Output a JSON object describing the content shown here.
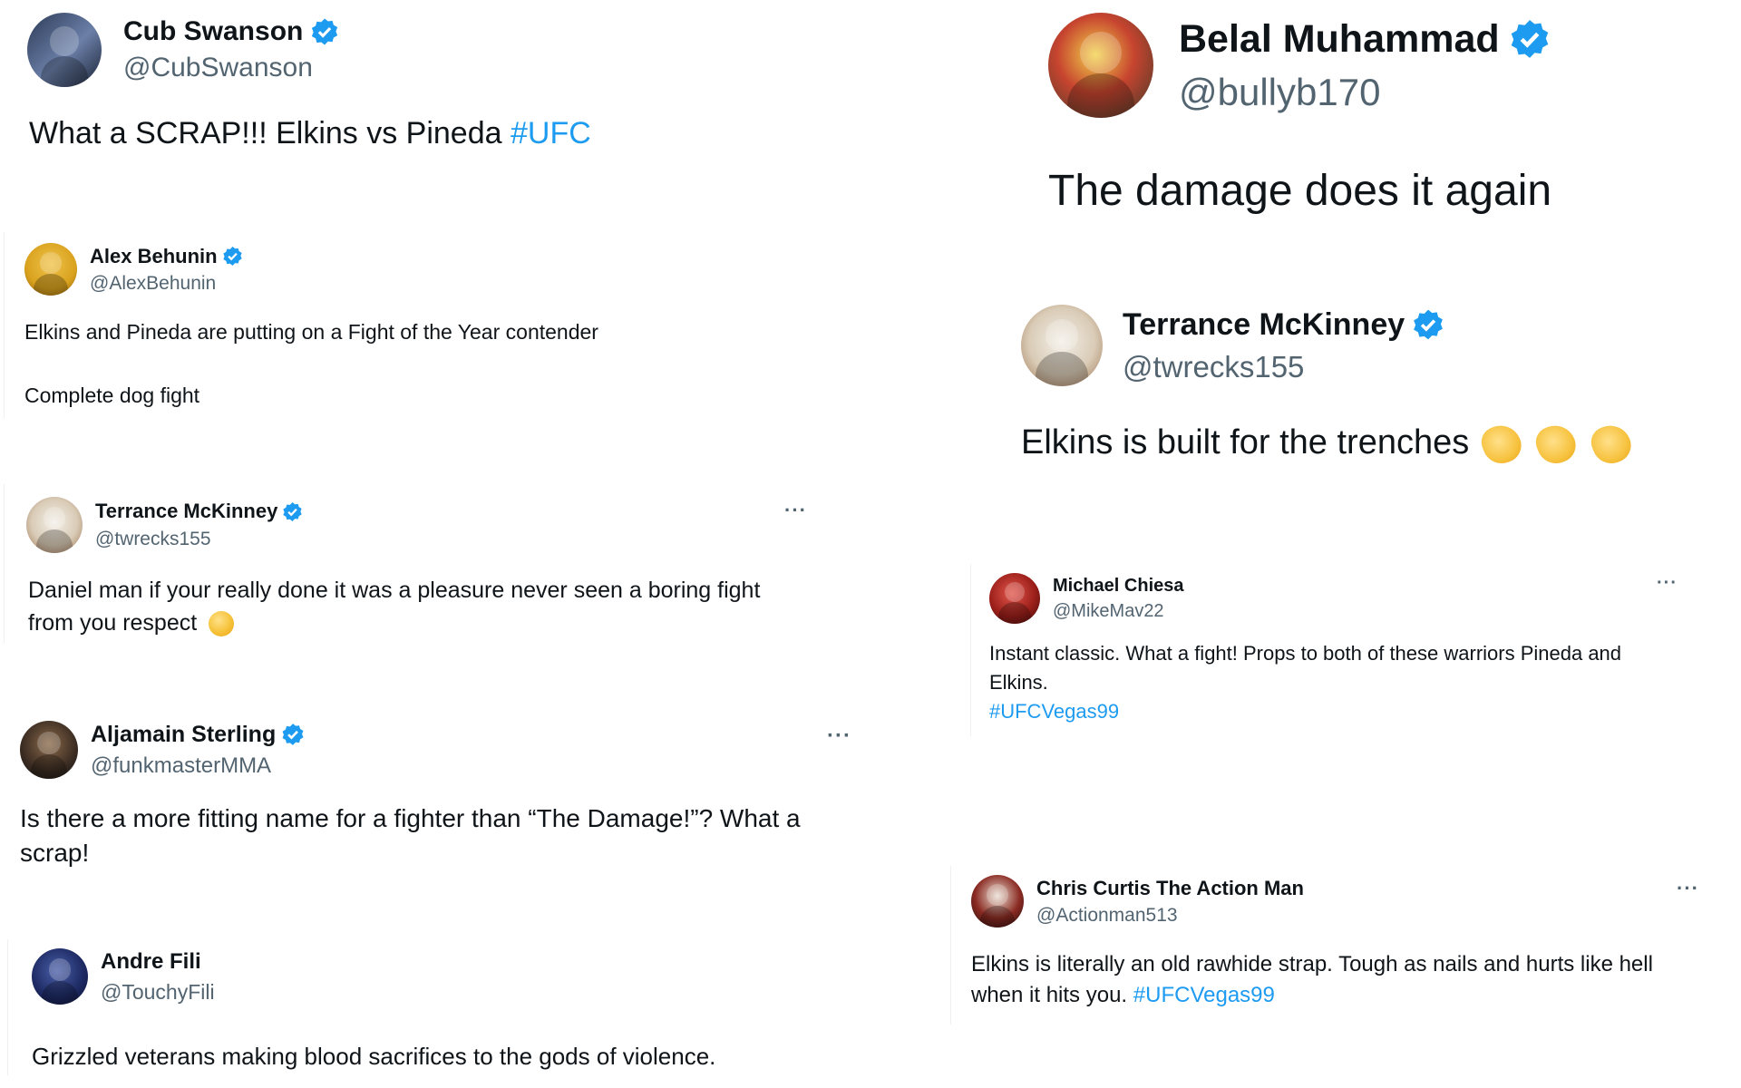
{
  "colors": {
    "link": "#1d9bf0",
    "verified": "#1d9bf0",
    "text": "#0f1419",
    "muted": "#536471"
  },
  "tweets": [
    {
      "name": "Cub Swanson",
      "handle": "@CubSwanson",
      "verified": true,
      "text": "What a SCRAP!!! Elkins vs Pineda ",
      "hashtag": "#UFC"
    },
    {
      "name": "Alex Behunin",
      "handle": "@AlexBehunin",
      "verified": true,
      "line1": "Elkins and Pineda are putting on a Fight of the Year contender",
      "line2": "Complete dog fight"
    },
    {
      "name": "Terrance McKinney",
      "handle": "@twrecks155",
      "verified": true,
      "more": "···",
      "line1": "Daniel man if your really done it was a pleasure never seen a boring fight",
      "line2": "from you respect",
      "emoji": "saluting-face"
    },
    {
      "name": "Aljamain Sterling",
      "handle": "@funkmasterMMA",
      "verified": true,
      "more": "···",
      "line1": "Is there a more fitting name for a fighter than “The Damage!”? What a",
      "line2": "scrap!"
    },
    {
      "name": "Andre Fili",
      "handle": "@TouchyFili",
      "verified": false,
      "text": "Grizzled veterans making blood sacrifices to the gods of violence."
    },
    {
      "name": "Belal Muhammad",
      "handle": "@bullyb170",
      "verified": true,
      "text": "The damage does it again"
    },
    {
      "name": "Terrance McKinney",
      "handle": "@twrecks155",
      "verified": true,
      "text": "Elkins is built for the trenches ",
      "emoji": "clapping-hands"
    },
    {
      "name": "Michael Chiesa",
      "handle": "@MikeMav22",
      "verified": false,
      "more": "···",
      "line1": "Instant classic. What a fight! Props to both of these warriors Pineda and",
      "line2": "Elkins.",
      "hashtag": "#UFCVegas99"
    },
    {
      "name": "Chris Curtis The Action Man",
      "handle": "@Actionman513",
      "verified": false,
      "more": "···",
      "line1": "Elkins is literally an old rawhide strap. Tough as nails and hurts like hell",
      "line2": "when it hits you. ",
      "hashtag": "#UFCVegas99"
    }
  ]
}
